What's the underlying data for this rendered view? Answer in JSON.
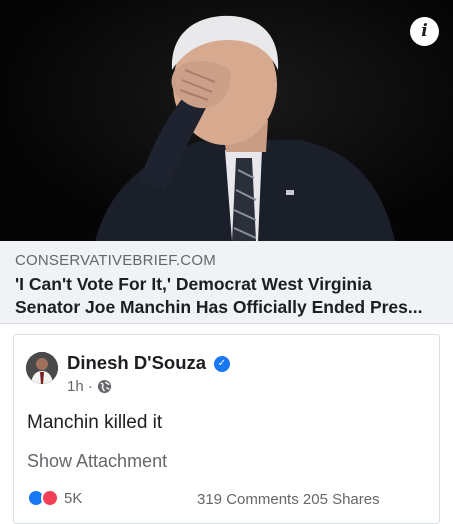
{
  "link": {
    "domain": "CONSERVATIVEBRIEF.COM",
    "title_line1": "'I Can't Vote For It,' Democrat West Virginia",
    "title_line2": "Senator Joe Manchin Has Officially Ended Pres...",
    "info_label": "i"
  },
  "post": {
    "author": "Dinesh D'Souza",
    "time": "1h",
    "separator": "·",
    "text": "Manchin killed it",
    "attachment_label": "Show Attachment",
    "reaction_count": "5K",
    "comments": "319 Comments",
    "shares": "205 Shares"
  },
  "icons": {
    "info": "info-icon",
    "verified": "verified-badge-icon",
    "audience": "globe-icon",
    "reactions": [
      "like-icon",
      "love-icon"
    ]
  },
  "colors": {
    "accent": "#1877f2",
    "love": "#f33e58",
    "text_primary": "#1c1e21",
    "text_secondary": "#65676b",
    "card_bg": "#f0f2f5"
  }
}
